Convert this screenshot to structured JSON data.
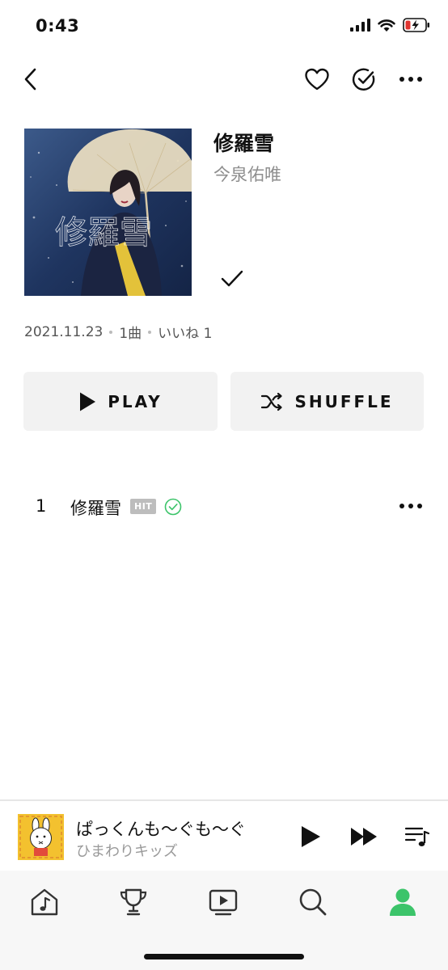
{
  "status_bar": {
    "time": "0:43"
  },
  "nav": {
    "back_icon": "chevron-left-icon",
    "like_icon": "heart-outline-icon",
    "check_icon": "check-circle-icon",
    "more_icon": "more-horizontal-icon"
  },
  "album": {
    "title": "修羅雪",
    "artist": "今泉佑唯",
    "art_text": "修羅雪",
    "release_date": "2021.11.23",
    "track_count": "1曲",
    "likes": "いいね 1"
  },
  "actions": {
    "play_label": "PLAY",
    "shuffle_label": "SHUFFLE"
  },
  "tracks": [
    {
      "number": "1",
      "title": "修羅雪",
      "badge": "HIT",
      "verified": true
    }
  ],
  "mini_player": {
    "title": "ぱっくんも〜ぐも〜ぐ",
    "artist": "ひまわりキッズ"
  },
  "tabs": [
    {
      "icon": "music-home-icon",
      "active": false
    },
    {
      "icon": "trophy-icon",
      "active": false
    },
    {
      "icon": "video-play-icon",
      "active": false
    },
    {
      "icon": "search-icon",
      "active": false
    },
    {
      "icon": "profile-icon",
      "active": true
    }
  ],
  "colors": {
    "accent_green": "#3cc46a",
    "button_bg": "#f2f2f2",
    "muted_text": "#8e8e8e",
    "battery_red": "#e0342f"
  }
}
